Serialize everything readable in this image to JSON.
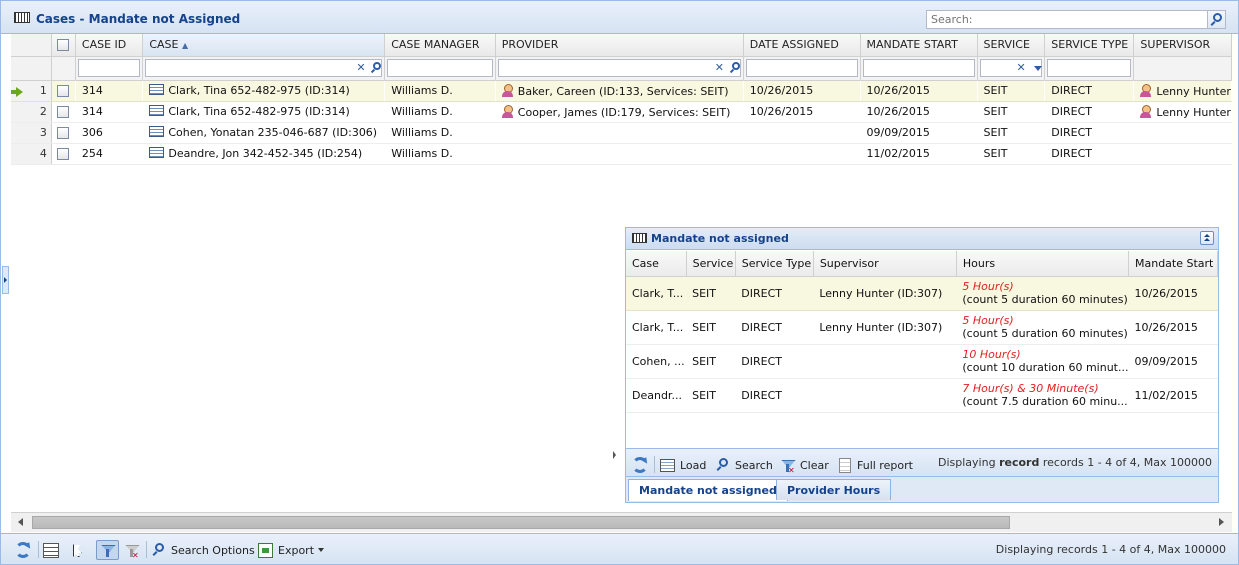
{
  "header": {
    "title": "Cases - Mandate not Assigned",
    "search_placeholder": "Search:"
  },
  "grid": {
    "columns": [
      "CASE ID",
      "CASE",
      "CASE MANAGER",
      "PROVIDER",
      "DATE ASSIGNED",
      "MANDATE START",
      "SERVICE",
      "SERVICE TYPE",
      "SUPERVISOR"
    ],
    "sort": {
      "column": "CASE",
      "direction": "asc"
    },
    "rows": [
      {
        "num": "1",
        "case_id": "314",
        "case": "Clark, Tina 652-482-975 (ID:314)",
        "manager": "Williams D.",
        "provider": "Baker, Careen (ID:133, Services: SEIT)",
        "date_assigned": "10/26/2015",
        "mandate_start": "10/26/2015",
        "service": "SEIT",
        "service_type": "DIRECT",
        "supervisor": "Lenny Hunter"
      },
      {
        "num": "2",
        "case_id": "314",
        "case": "Clark, Tina 652-482-975 (ID:314)",
        "manager": "Williams D.",
        "provider": "Cooper, James (ID:179, Services: SEIT)",
        "date_assigned": "10/26/2015",
        "mandate_start": "10/26/2015",
        "service": "SEIT",
        "service_type": "DIRECT",
        "supervisor": "Lenny Hunter"
      },
      {
        "num": "3",
        "case_id": "306",
        "case": "Cohen, Yonatan 235-046-687 (ID:306)",
        "manager": "Williams D.",
        "provider": "",
        "date_assigned": "",
        "mandate_start": "09/09/2015",
        "service": "SEIT",
        "service_type": "DIRECT",
        "supervisor": ""
      },
      {
        "num": "4",
        "case_id": "254",
        "case": "Deandre, Jon 342-452-345 (ID:254)",
        "manager": "Williams D.",
        "provider": "",
        "date_assigned": "",
        "mandate_start": "11/02/2015",
        "service": "SEIT",
        "service_type": "DIRECT",
        "supervisor": ""
      }
    ]
  },
  "bottom_toolbar": {
    "search_options": "Search Options",
    "export": "Export",
    "status": "Displaying records 1 - 4 of 4, Max 100000"
  },
  "subpanel": {
    "title": "Mandate not assigned",
    "columns": [
      "Case",
      "Service",
      "Service Type",
      "Supervisor",
      "Hours",
      "Mandate Start"
    ],
    "rows": [
      {
        "case": "Clark, T...",
        "service": "SEIT",
        "service_type": "DIRECT",
        "supervisor": "Lenny Hunter (ID:307)",
        "hours": "5 Hour(s)",
        "hours_detail": "(count 5 duration 60 minutes)",
        "mandate_start": "10/26/2015"
      },
      {
        "case": "Clark, T...",
        "service": "SEIT",
        "service_type": "DIRECT",
        "supervisor": "Lenny Hunter (ID:307)",
        "hours": "5 Hour(s)",
        "hours_detail": "(count 5 duration 60 minutes)",
        "mandate_start": "10/26/2015"
      },
      {
        "case": "Cohen, ...",
        "service": "SEIT",
        "service_type": "DIRECT",
        "supervisor": "",
        "hours": "10 Hour(s)",
        "hours_detail": "(count 10 duration 60 minut...",
        "mandate_start": "09/09/2015"
      },
      {
        "case": "Deandr...",
        "service": "SEIT",
        "service_type": "DIRECT",
        "supervisor": "",
        "hours": "7 Hour(s) & 30 Minute(s)",
        "hours_detail": "(count 7.5 duration 60 minu...",
        "mandate_start": "11/02/2015"
      }
    ],
    "toolbar": {
      "load": "Load",
      "search": "Search",
      "clear": "Clear",
      "full_report": "Full report",
      "status_prefix": "Displaying",
      "status_bold": "record",
      "status_suffix": "records 1 - 4 of 4, Max 100000"
    },
    "tabs": [
      "Mandate not assigned",
      "Provider Hours"
    ]
  },
  "colors": {
    "title": "#15428b",
    "border": "#99bbe8",
    "selected_row": "#f8f8e0",
    "hours_red": "#e02020"
  }
}
